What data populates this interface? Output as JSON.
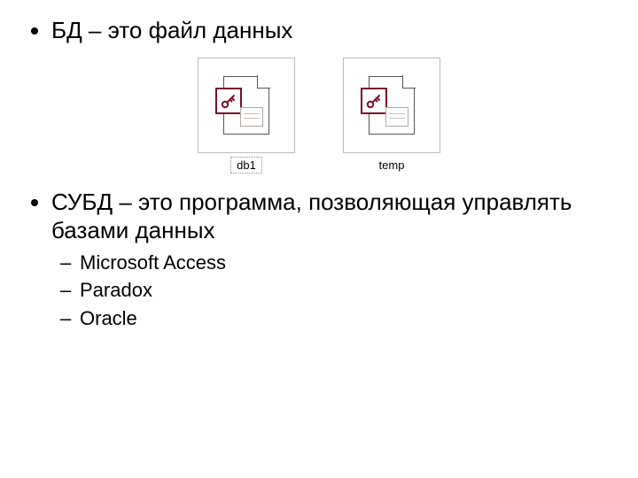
{
  "bullets": {
    "item1": "БД – это файл данных",
    "item2": "СУБД – это программа, позволяющая управлять базами данных",
    "sub1": "Microsoft Access",
    "sub2": "Paradox",
    "sub3": "Oracle"
  },
  "files": {
    "file1_label": "db1",
    "file2_label": "temp"
  }
}
